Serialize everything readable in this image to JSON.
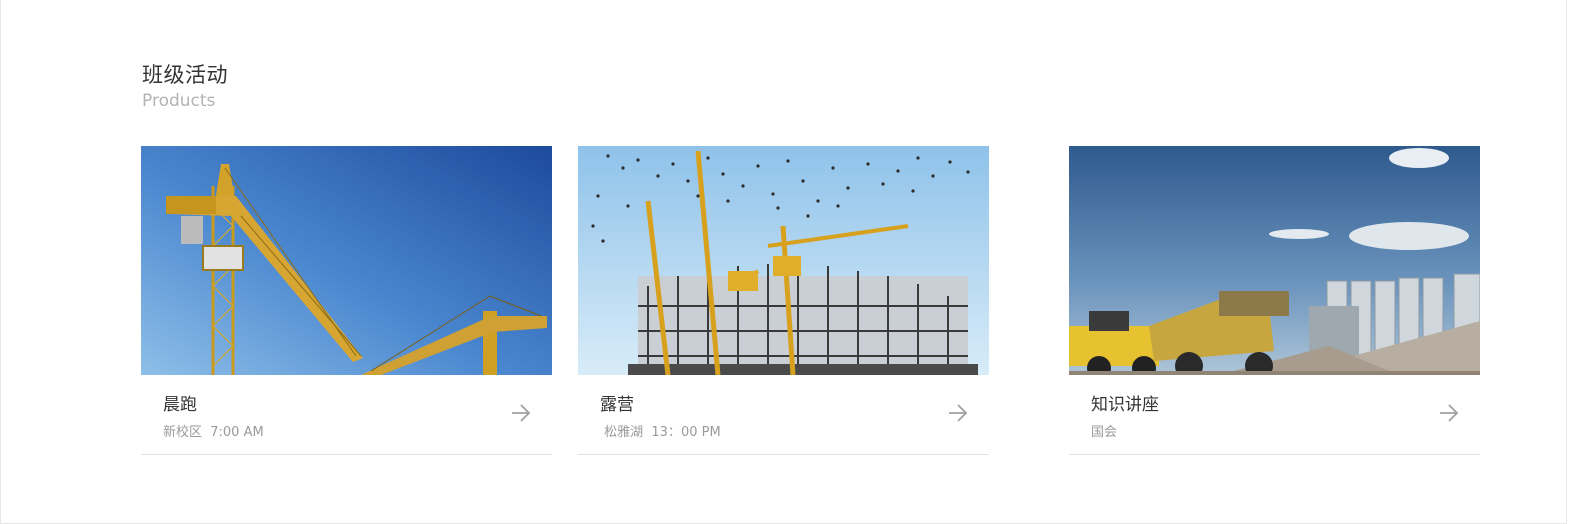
{
  "section": {
    "title": "班级活动",
    "subtitle": "Products"
  },
  "cards": [
    {
      "title": "晨跑",
      "meta": "新校区  7:00 AM",
      "image": "yellow-cranes-blue-sky-photo",
      "icon": "arrow-right-icon"
    },
    {
      "title": "露营",
      "meta": " 松雅湖  13：00 PM",
      "image": "cranes-scaffold-birds-photo",
      "icon": "arrow-right-icon"
    },
    {
      "title": "知识讲座",
      "meta": "国会",
      "image": "loader-silos-gravel-photo",
      "icon": "arrow-right-icon"
    }
  ],
  "colors": {
    "title": "#333333",
    "subtitle": "#b3b3b3",
    "meta": "#9a9a9a",
    "arrow": "#a0a0a0",
    "divider": "#e3e3e3"
  }
}
